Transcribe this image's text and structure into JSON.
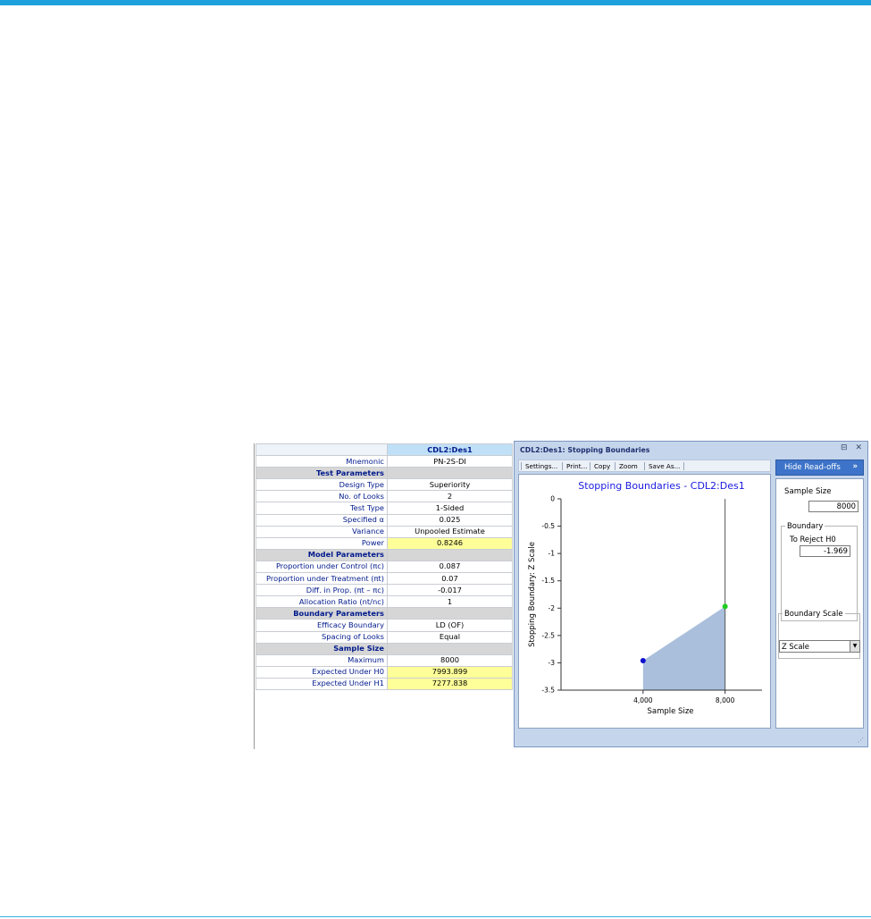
{
  "design_table": {
    "column_header": "CDL2:Des1",
    "rows": [
      {
        "type": "row",
        "label": "Mnemonic",
        "value": "PN-2S-DI",
        "highlight": false
      },
      {
        "type": "section",
        "label": "Test Parameters"
      },
      {
        "type": "row",
        "label": "Design Type",
        "value": "Superiority",
        "highlight": false
      },
      {
        "type": "row",
        "label": "No. of Looks",
        "value": "2",
        "highlight": false
      },
      {
        "type": "row",
        "label": "Test Type",
        "value": "1-Sided",
        "highlight": false
      },
      {
        "type": "row",
        "label": "Specified α",
        "value": "0.025",
        "highlight": false
      },
      {
        "type": "row",
        "label": "Variance",
        "value": "Unpooled Estimate",
        "highlight": false
      },
      {
        "type": "row",
        "label": "Power",
        "value": "0.8246",
        "highlight": true
      },
      {
        "type": "section",
        "label": "Model Parameters"
      },
      {
        "type": "row",
        "label": "Proportion under Control (πc)",
        "value": "0.087",
        "highlight": false
      },
      {
        "type": "row",
        "label": "Proportion under Treatment (πt)",
        "value": "0.07",
        "highlight": false
      },
      {
        "type": "row",
        "label": "Diff. in Prop. (πt – πc)",
        "value": "-0.017",
        "highlight": false
      },
      {
        "type": "row",
        "label": "Allocation Ratio (nt/nc)",
        "value": "1",
        "highlight": false
      },
      {
        "type": "section",
        "label": "Boundary Parameters"
      },
      {
        "type": "row",
        "label": "Efficacy Boundary",
        "value": "LD (OF)",
        "highlight": false
      },
      {
        "type": "row",
        "label": "Spacing of Looks",
        "value": "Equal",
        "highlight": false
      },
      {
        "type": "section",
        "label": "Sample Size"
      },
      {
        "type": "row",
        "label": "Maximum",
        "value": "8000",
        "highlight": false
      },
      {
        "type": "row",
        "label": "Expected Under H0",
        "value": "7993.899",
        "highlight": true
      },
      {
        "type": "row",
        "label": "Expected Under H1",
        "value": "7277.838",
        "highlight": true
      }
    ]
  },
  "chart_window": {
    "title": "CDL2:Des1: Stopping Boundaries",
    "window_buttons": [
      "⊟",
      "✕"
    ],
    "toolbar": [
      "Settings...",
      "Print...",
      "Copy",
      "Zoom",
      "Save As..."
    ],
    "hide_readoffs_label": "Hide Read-offs",
    "hide_readoffs_arrow": "»",
    "readoffs": {
      "sample_size_label": "Sample Size",
      "sample_size_value": "8000",
      "boundary_group_label": "Boundary",
      "to_reject_label": "To Reject H0",
      "boundary_value": "-1.969",
      "boundary_scale_label": "Boundary Scale",
      "boundary_scale_value": "Z Scale"
    }
  },
  "chart_data": {
    "type": "line",
    "title": "Stopping Boundaries - CDL2:Des1",
    "xlabel": "Sample Size",
    "ylabel": "Stopping Boundary: Z Scale",
    "xlim": [
      0,
      9800
    ],
    "ylim": [
      -3.5,
      0
    ],
    "x_ticks": [
      4000,
      8000
    ],
    "x_tick_labels": [
      "4,000",
      "8,000"
    ],
    "y_ticks": [
      0,
      -0.5,
      -1,
      -1.5,
      -2,
      -2.5,
      -3,
      -3.5
    ],
    "y_tick_labels": [
      "0",
      "-0.5",
      "-1",
      "-1.5",
      "-2",
      "-2.5",
      "-3",
      "-3.5"
    ],
    "vertical_line_x": 8000,
    "fill_color": "#a9bfdc",
    "series": [
      {
        "x": [
          4000,
          8000
        ],
        "y": [
          -2.961,
          -1.969
        ],
        "point_colors": [
          "#1010d0",
          "#22cc22"
        ]
      }
    ]
  }
}
